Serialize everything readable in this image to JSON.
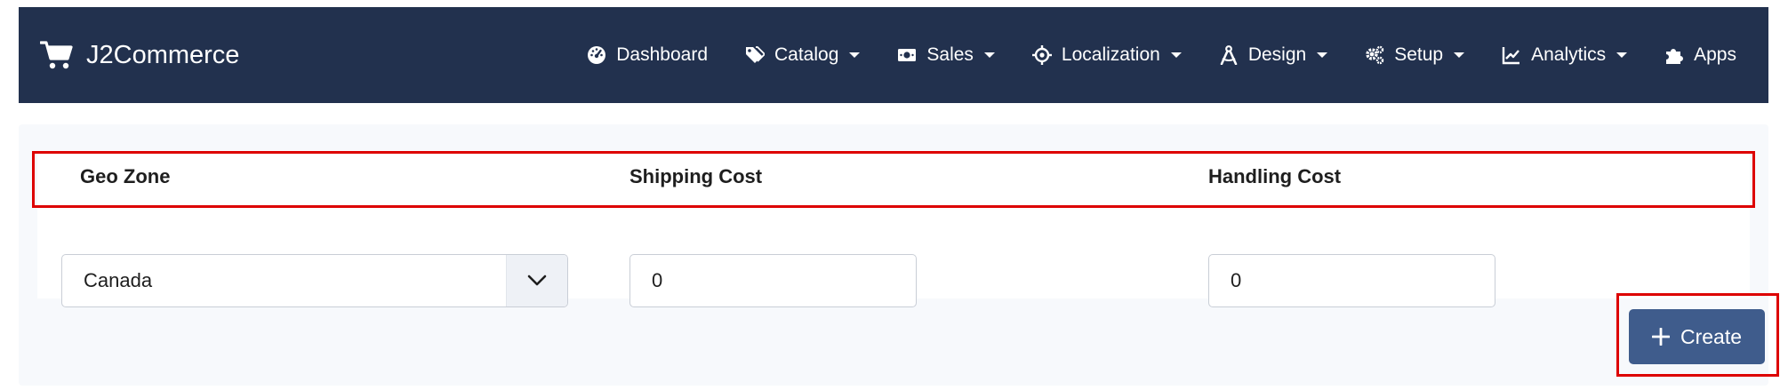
{
  "navbar": {
    "brand": "J2Commerce",
    "items": [
      {
        "label": "Dashboard",
        "icon": "gauge-icon",
        "dropdown": false
      },
      {
        "label": "Catalog",
        "icon": "tags-icon",
        "dropdown": true
      },
      {
        "label": "Sales",
        "icon": "money-icon",
        "dropdown": true
      },
      {
        "label": "Localization",
        "icon": "crosshairs-icon",
        "dropdown": true
      },
      {
        "label": "Design",
        "icon": "compass-drafting-icon",
        "dropdown": true
      },
      {
        "label": "Setup",
        "icon": "gears-icon",
        "dropdown": true
      },
      {
        "label": "Analytics",
        "icon": "chart-line-icon",
        "dropdown": true
      },
      {
        "label": "Apps",
        "icon": "puzzle-icon",
        "dropdown": false
      }
    ]
  },
  "form": {
    "columns": {
      "geo_zone": "Geo Zone",
      "shipping_cost": "Shipping Cost",
      "handling_cost": "Handling Cost"
    },
    "geo_zone_value": "Canada",
    "shipping_cost_value": "0",
    "handling_cost_value": "0",
    "create_label": "Create"
  },
  "colors": {
    "navbar_bg": "#22314e",
    "panel_bg": "#f7f9fc",
    "button_bg": "#3f5c8c",
    "highlight": "#dd0000"
  }
}
